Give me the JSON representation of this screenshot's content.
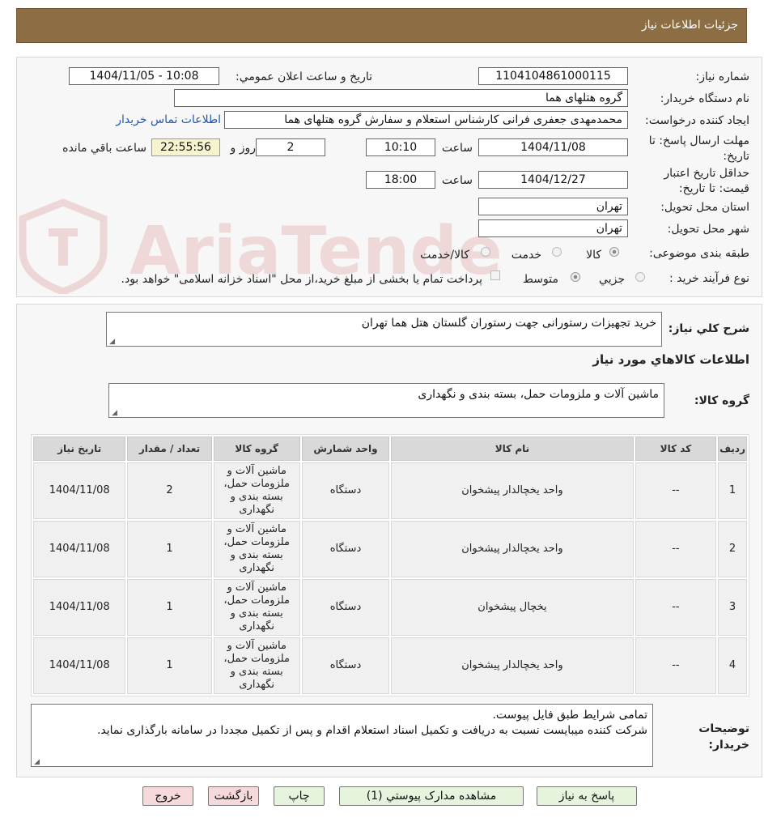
{
  "header": {
    "title": "جزئیات اطلاعات نیاز"
  },
  "details": {
    "need_number_label": "شماره نیاز:",
    "need_number": "1104104861000115",
    "announce_label": "تاریخ و ساعت اعلان عمومي:",
    "announce_value": "1404/11/05 - 10:08",
    "buyer_org_label": "نام دستگاه خريدار:",
    "buyer_org": "گروه هتلهای هما",
    "creator_label": "ايجاد کننده درخواست:",
    "creator": "محمدمهدی جعفری فرانی کارشناس استعلام و سفارش گروه هتلهای هما",
    "contact_link": "اطلاعات تماس خریدار",
    "deadline_label": "مهلت ارسال پاسخ: تا تاریخ:",
    "deadline_date": "1404/11/08",
    "time_label": "ساعت",
    "deadline_time": "10:10",
    "days_value": "2",
    "days_label": "روز و",
    "remaining_time": "22:55:56",
    "remaining_label": "ساعت باقي مانده",
    "validity_label": "حداقل تاریخ اعتبار قیمت: تا تاریخ:",
    "validity_date": "1404/12/27",
    "validity_time": "18:00",
    "province_label": "استان محل تحویل:",
    "province": "تهران",
    "city_label": "شهر محل تحویل:",
    "city": "تهران",
    "category_label": "طبقه بندی موضوعی:",
    "category_options": [
      "کالا",
      "خدمت",
      "کالا/خدمت"
    ],
    "category_selected": "کالا",
    "process_label": "نوع فرآیند خرید :",
    "process_options": [
      "جزیي",
      "متوسط"
    ],
    "process_selected": "متوسط",
    "payment_note": "پرداخت تمام یا بخشی از مبلغ خرید،از محل \"اسناد خزانه اسلامی\" خواهد بود."
  },
  "summary": {
    "general_desc_label": "شرح کلي نياز:",
    "general_desc": "خرید تجهیزات رستورانی جهت رستوران گلستان هتل هما تهران",
    "goods_info_title": "اطلاعات کالاهاي مورد نياز",
    "goods_group_label": "گروه کالا:",
    "goods_group": "ماشین آلات و ملزومات حمل، بسته بندی و نگهداری"
  },
  "table": {
    "headers": [
      "رديف",
      "کد کالا",
      "نام کالا",
      "واحد شمارش",
      "گروه کالا",
      "تعداد / مقدار",
      "تاريخ نياز"
    ],
    "rows": [
      {
        "row": "1",
        "code": "--",
        "name": "واحد یخچالدار پیشخوان",
        "unit": "دستگاه",
        "group": "ماشین آلات و ملزومات حمل، بسته بندی و نگهداری",
        "qty": "2",
        "date": "1404/11/08"
      },
      {
        "row": "2",
        "code": "--",
        "name": "واحد یخچالدار پیشخوان",
        "unit": "دستگاه",
        "group": "ماشین آلات و ملزومات حمل، بسته بندی و نگهداری",
        "qty": "1",
        "date": "1404/11/08"
      },
      {
        "row": "3",
        "code": "--",
        "name": "یخچال پیشخوان",
        "unit": "دستگاه",
        "group": "ماشین آلات و ملزومات حمل، بسته بندی و نگهداری",
        "qty": "1",
        "date": "1404/11/08"
      },
      {
        "row": "4",
        "code": "--",
        "name": "واحد یخچالدار پیشخوان",
        "unit": "دستگاه",
        "group": "ماشین آلات و ملزومات حمل، بسته بندی و نگهداری",
        "qty": "1",
        "date": "1404/11/08"
      }
    ]
  },
  "buyer_notes": {
    "label": "توضیحات خریدار:",
    "line1": "تمامی شرایط طبق فایل پیوست.",
    "line2": "شرکت کننده میبایست نسبت به دریافت و تکمیل اسناد استعلام اقدام و پس از تکمیل مجددا در سامانه بارگذاری نماید."
  },
  "buttons": {
    "reply": "پاسخ به نیاز",
    "attachments": "مشاهده مدارک پیوستي (1)",
    "print": "چاپ",
    "back": "بازگشت",
    "exit": "خروج"
  },
  "watermark": {
    "text": "AriaTender.neT"
  },
  "colors": {
    "header_bg": "#8d6e44",
    "link": "#1f57b5",
    "time_bg": "#f6f3cf",
    "btn_green": "#e7f4dd",
    "btn_pink": "#f6d9da"
  }
}
